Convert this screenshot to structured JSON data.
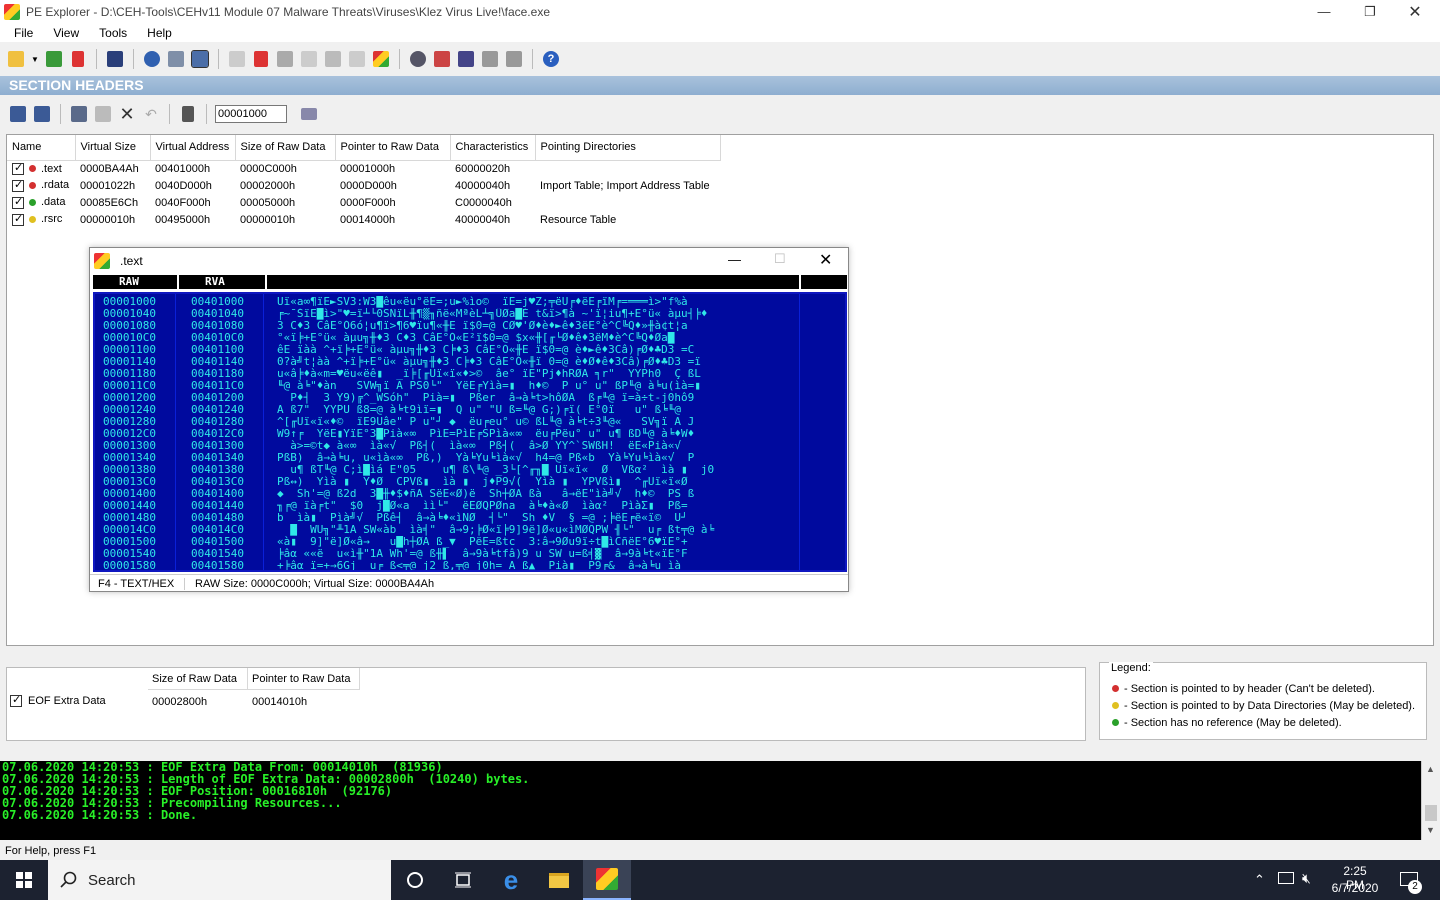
{
  "window": {
    "title": "PE Explorer - D:\\CEH-Tools\\CEHv11 Module 07 Malware Threats\\Viruses\\Klez Virus Live!\\face.exe"
  },
  "menu": {
    "file": "File",
    "view": "View",
    "tools": "Tools",
    "help": "Help"
  },
  "section_bar": "SECTION HEADERS",
  "address_value": "00001000",
  "sections": {
    "headers": [
      "Name",
      "Virtual Size",
      "Virtual Address",
      "Size of Raw Data",
      "Pointer to Raw Data",
      "Characteristics",
      "Pointing Directories"
    ],
    "rows": [
      {
        "name": ".text",
        "dot": "#d33030",
        "vsize": "0000BA4Ah",
        "vaddr": "00401000h",
        "rawsize": "0000C000h",
        "rawptr": "00001000h",
        "chars": "60000020h",
        "dirs": ""
      },
      {
        "name": ".rdata",
        "dot": "#d33030",
        "vsize": "00001022h",
        "vaddr": "0040D000h",
        "rawsize": "00002000h",
        "rawptr": "0000D000h",
        "chars": "40000040h",
        "dirs": "Import Table; Import Address Table"
      },
      {
        "name": ".data",
        "dot": "#2aa02a",
        "vsize": "00085E6Ch",
        "vaddr": "0040F000h",
        "rawsize": "00005000h",
        "rawptr": "0000F000h",
        "chars": "C0000040h",
        "dirs": ""
      },
      {
        "name": ".rsrc",
        "dot": "#e0c020",
        "vsize": "00000010h",
        "vaddr": "00495000h",
        "rawsize": "00000010h",
        "rawptr": "00014000h",
        "chars": "40000040h",
        "dirs": "Resource Table"
      }
    ]
  },
  "hex": {
    "title": ".text",
    "col_raw": "RAW",
    "col_rva": "RVA",
    "rows": [
      [
        "00001000",
        "00401000",
        "Uï«a∞¶ïE►SV3:W3█êu«ëu°ëE=;u►%ìo©  ïE=j♥Z;╤ëU╒♦ëE╒ïM╒=═══ì>\"f%à"
      ],
      [
        "00001040",
        "00401040",
        "╒~¯ŠïE█ì>\"♥=ï┴└0SÑïL╫¶▒╖ñë«MªèL┴╗ÛØa█É t&ï>¶à ~'ï¦iu¶+E°ü« àµu┤╞♦"
      ],
      [
        "00001080",
        "00401080",
        "3 C♦3 CâE°Ó6ó¦u¶ï>¶6♥ïu¶«╫E ï$0=@ CØ♥'Ø♦è♦►ê♦3ëE°è^C╚Q♦»╫à¢t¦a"
      ],
      [
        "000010C0",
        "004010C0",
        "°«ï╞+E°ü« àµu╗╫♦3 C♦3 CâE°Ó«E²ï$0=@ $x«╫[╓└Ø♦ê♦3ëM♦è^C╚Q♦Øa█"
      ],
      [
        "00001100",
        "00401100",
        "êE ïàà ^+ï╞+E°ü« àµu╗╫♦3 C╞♦3 CâE°Ó«╫E ï$0=@ è♦►ê♦3Câ)╒Ø♦♣D3 =C"
      ],
      [
        "00001140",
        "00401140",
        "0?à╝t¦àà ^+ï╞+E°ü« àµu╗╫♦3 C╞♦3 CâE°Ó«╫ï 0=@ è♦Ø♦ê♦3Câ)╒Ø♦♣D3 =ï"
      ],
      [
        "00001180",
        "00401180",
        "u«â╞♦à«m=♥ëu«ëê▮  _ï╞[╓Uï«ï«♦>©  âe° ïE\"Pj♦hRØA ╕r\"  YYPh0  Ç ßL"
      ],
      [
        "000011C0",
        "004011C0",
        "╙@ à╘\"♦àn   SVW╗ï A PS0└\"  YëE╒Yìà=▮  h♦©  P u° u\" ßP╙@ à╘u(ìà=▮"
      ],
      [
        "00001200",
        "00401200",
        "  P♦┤  3 Y9)╔^_WSóh\"  Pià=▮  Pßer  â→à╘t>hôØA  ß╒╙@ ï=à÷t-j0hô9"
      ],
      [
        "00001240",
        "00401240",
        "A ß7\"  YYPU ß8=@ à╘t9ìï=▮  Q u\" \"U ß=╙@ G;)╒ï( E°0ï   u\" ß╘╙@"
      ],
      [
        "00001280",
        "00401280",
        "^[╓Uï«ï«♦©  ïE9Uâe\" P u\"┘ ◆  ëu╒eu° u© ßL╙@ à╘t÷3╙@«   SV╗ï A J"
      ],
      [
        "000012C0",
        "004012C0",
        "W9↑╒  YëE▮YïE°3█Pià«∞  PìE=PìE╒SPìà«∞  ëu╒Pëu° u\" u¶ ßD╙@ à╘♦W♦"
      ],
      [
        "00001300",
        "00401300",
        "  à>=©t◆ à«∞  ìà«√  Pß┤(  ìà«∞  Pß┤(  â>Ø YY^`SWßH!  ëE«Pià«√"
      ],
      [
        "00001340",
        "00401340",
        "PßB)  â→à╘u, u«ìà«∞  Pß,)  Yà╘Yu╘ìà«√  h4=@ Pß«b  Yà╘Yu╘ìà«√  P"
      ],
      [
        "00001380",
        "00401380",
        "  u¶ ßT╙@ C;ì█ìá E\"05    u¶ ß\\╙@ _3└[^╓╖█ Uï«ï«  Ø  Vßα²  ìà ▮  j0"
      ],
      [
        "000013C0",
        "004013C0",
        "Pß↔)  Yìà ▮  Y♦Ø  CPVß▮  ìà ▮  j♦P9√(  Yìà ▮  YPVßì▮  ^╓Uï«ï«Ø"
      ],
      [
        "00001400",
        "00401400",
        "◆  Sh'=@ ß2d  3█╫♦$♦ñA SëE«Ø)ë  Sh┼ØA ßà   â→ëE\"ìà╝√  h♦©  PS ß"
      ],
      [
        "00001440",
        "00401440",
        "╖╒@ ïà╒t\"  $0  j█Ø«a  ìì└\"  ëEØQPØna  à╘♦à«Ø  ìàα²  PìàΣ▮  Pß="
      ],
      [
        "00001480",
        "00401480",
        "b  ìà▮  Pìà╝√  Pßê┤  â→à╘♦«ìNØ  ┤└\"  Sh ♦V  § =@ ;╞ëE╒ë«ï©  U┘"
      ],
      [
        "000014C0",
        "004014C0",
        "  █  WU╗\"╨1A SW«àb  ìà╡\"  â→9;╞Ø«ï╞9]9ë]Ø«u«ìMØQPW ╢└\"  u╒ ßt╤@ à╘"
      ],
      [
        "00001500",
        "00401500",
        "«à▮  9]\"ë]Ø«â→   u█h┼ØA ß_▼  PëE=ßtc  3:â→9Øu9ï÷t█ìCñëE°6♥ïE°+"
      ],
      [
        "00001540",
        "00401540",
        "╞âα ««ë  u«ì╫\"1A Wh'=@ ß╫▌  â→9à╘tfâ)9 u SW u=ß╡▓  â→9à╘t«ïE°F"
      ],
      [
        "00001580",
        "00401580",
        "+╞âα ï=+→6Gj  u╒ ß<╤@ j2 ß,╤@ j0h= A ß▲  Pià▮  P9╒&  â→à╘u ìà"
      ]
    ],
    "status_mode": "F4 - TEXT/HEX",
    "status_info": "RAW Size: 0000C000h;  Virtual Size: 0000BA4Ah"
  },
  "eof": {
    "headers": [
      "Size of Raw Data",
      "Pointer to Raw Data"
    ],
    "name": "EOF Extra Data",
    "rawsize": "00002800h",
    "rawptr": "00014010h"
  },
  "legend": {
    "title": "Legend:",
    "items": [
      {
        "color": "#d33030",
        "text": "- Section is pointed to by header (Can't be deleted)."
      },
      {
        "color": "#e0c020",
        "text": "- Section is pointed to by Data Directories (May be deleted)."
      },
      {
        "color": "#2aa02a",
        "text": "- Section has no reference (May be deleted)."
      }
    ]
  },
  "log": [
    "07.06.2020 14:20:53 : EOF Extra Data From: 00014010h  (81936)",
    "07.06.2020 14:20:53 : Length of EOF Extra Data: 00002800h  (10240) bytes.",
    "07.06.2020 14:20:53 : EOF Position: 00016810h  (92176)",
    "07.06.2020 14:20:53 : Precompiling Resources...",
    "07.06.2020 14:20:53 : Done."
  ],
  "status": "For Help, press F1",
  "taskbar": {
    "search": "Search",
    "time": "2:25 PM",
    "date": "6/7/2020",
    "notif_count": "2"
  }
}
